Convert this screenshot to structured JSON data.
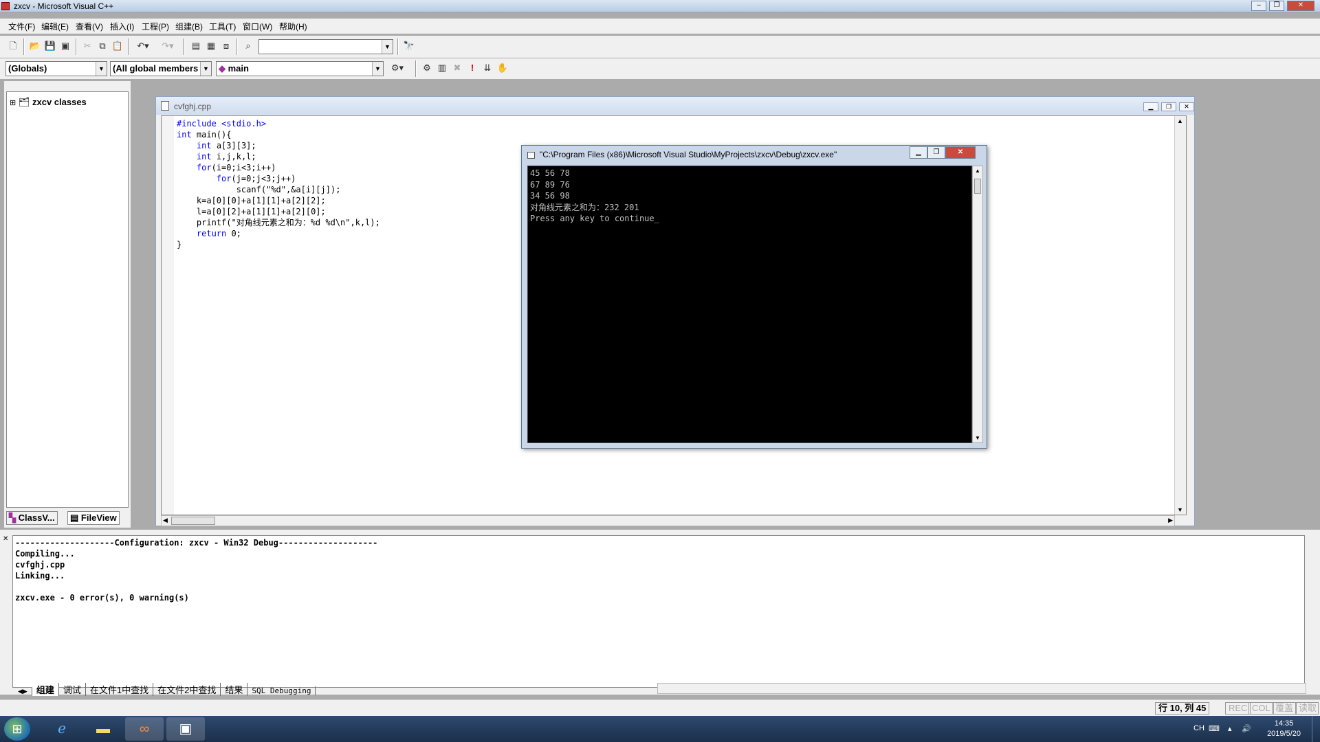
{
  "window": {
    "title": "zxcv - Microsoft Visual C++",
    "btn_min": "‒",
    "btn_max": "❐",
    "btn_close": "✕"
  },
  "menu": [
    "文件(F)",
    "编辑(E)",
    "查看(V)",
    "插入(I)",
    "工程(P)",
    "组建(B)",
    "工具(T)",
    "窗口(W)",
    "帮助(H)"
  ],
  "toolbar": {
    "find_value": "",
    "globals": "(Globals)",
    "members": "(All global members",
    "function": "main"
  },
  "classview": {
    "root": "zxcv classes",
    "tab_classview": "ClassV...",
    "tab_fileview": "FileView"
  },
  "document": {
    "title": "cvfghj.cpp",
    "code_lines": [
      "#include <stdio.h>",
      "int main(){",
      "    int a[3][3];",
      "    int i,j,k,l;",
      "    for(i=0;i<3;i++)",
      "        for(j=0;j<3;j++)",
      "            scanf(\"%d\",&a[i][j]);",
      "    k=a[0][0]+a[1][1]+a[2][2];",
      "    l=a[0][2]+a[1][1]+a[2][0];",
      "    printf(\"对角线元素之和为：%d %d\\n\",k,l);",
      "    return 0;",
      "}"
    ]
  },
  "console": {
    "title": "\"C:\\Program Files (x86)\\Microsoft Visual Studio\\MyProjects\\zxcv\\Debug\\zxcv.exe\"",
    "lines": [
      "45 56 78",
      "67 89 76",
      "34 56 98",
      "对角线元素之和为：232 201",
      "Press any key to continue_"
    ]
  },
  "output": {
    "lines": [
      "--------------------Configuration: zxcv - Win32 Debug--------------------",
      "Compiling...",
      "cvfghj.cpp",
      "Linking...",
      "",
      "zxcv.exe - 0 error(s), 0 warning(s)"
    ],
    "tabs": [
      "组建",
      "调试",
      "在文件1中查找",
      "在文件2中查找",
      "结果",
      "SQL Debugging"
    ]
  },
  "status": {
    "position": "行 10, 列 45",
    "rec": "REC",
    "col": "COL",
    "ovr": "覆盖",
    "read": "读取"
  },
  "taskbar": {
    "lang": "CH",
    "time": "14:35",
    "date": "2019/5/20"
  }
}
